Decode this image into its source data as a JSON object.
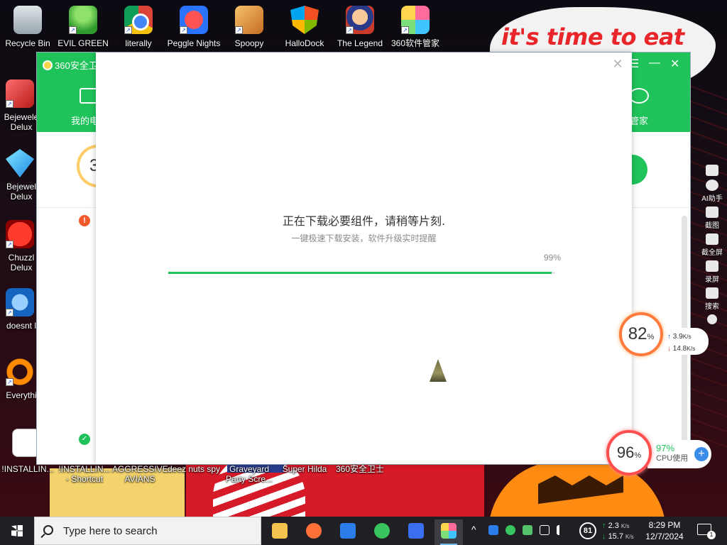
{
  "wallpaper": {
    "bubble_text": "it's time to eat shit"
  },
  "desktop": {
    "top_icons": [
      {
        "label": "Recycle Bin",
        "icon": "recycle-bin-icon"
      },
      {
        "label": "EVIL GREEN",
        "icon": "green-figure-icon"
      },
      {
        "label": "literally",
        "icon": "chrome-icon"
      },
      {
        "label": "Peggle Nights",
        "icon": "peggle-icon"
      },
      {
        "label": "Spoopy",
        "icon": "spoopy-icon"
      },
      {
        "label": "HalloDock",
        "icon": "windows-shield-icon"
      },
      {
        "label": "The Legend",
        "icon": "legend-character-icon"
      },
      {
        "label": "360软件管家",
        "icon": "360-software-icon"
      }
    ],
    "left_icons": [
      {
        "label": "Bejewele Delux",
        "icon": "bejeweled-icon"
      },
      {
        "label": "Bejewel Delux",
        "icon": "bejeweled-diamond-icon"
      },
      {
        "label": "Chuzzl Delux",
        "icon": "chuzzle-icon"
      },
      {
        "label": "doesnt l",
        "icon": "blue-bird-icon"
      },
      {
        "label": "Everythi",
        "icon": "everything-search-icon"
      }
    ],
    "bottom_labels": [
      {
        "label": "!INSTALLIN..."
      },
      {
        "label": "!INSTALLIN... - Shortcut"
      },
      {
        "label": "AGGRESSIVE AVIANS"
      },
      {
        "label": "deez nuts spy"
      },
      {
        "label": "Graveyard Party Scre..."
      },
      {
        "label": "Super Hilda"
      },
      {
        "label": "360安全卫士"
      }
    ]
  },
  "app_window": {
    "title": "360安全卫",
    "nav_left_label": "我的电",
    "nav_right_label": "件管家",
    "menu_glyph": "☰",
    "minimize_glyph": "—",
    "close_glyph": "✕",
    "partial_digit": "3"
  },
  "dialog": {
    "close_glyph": "✕",
    "title": "正在下载必要组件，请稍等片刻.",
    "subtitle": "一键极速下载安装，软件升级实时提醒",
    "progress": {
      "value": 99,
      "label": "99%"
    },
    "accent": "#1fc35a"
  },
  "side_toolbar": {
    "items": [
      {
        "label": "",
        "icon": "shield-check-icon"
      },
      {
        "label": "AI助手",
        "icon": "ai-assistant-icon"
      },
      {
        "label": "截图",
        "icon": "camera-icon"
      },
      {
        "label": "截全屏",
        "icon": "screen-capture-icon"
      },
      {
        "label": "录屏",
        "icon": "video-record-icon"
      },
      {
        "label": "搜索",
        "icon": "search-icon"
      },
      {
        "label": "",
        "icon": "settings-icon"
      }
    ]
  },
  "net_monitor": {
    "percent": "82",
    "unit": "%",
    "upload": "3.9",
    "upload_unit": "K/s",
    "download": "14.8",
    "download_unit": "K/s"
  },
  "cpu_monitor": {
    "percent": "96",
    "unit": "%",
    "cpu_value": "97%",
    "cpu_label": "CPU使用",
    "plus": "+"
  },
  "taskbar": {
    "search_placeholder": "Type here to search",
    "apps": [
      {
        "name": "file-explorer",
        "icon": "folder-icon",
        "color": "#f3c24f"
      },
      {
        "name": "firefox",
        "icon": "firefox-icon",
        "color": "#ff7139"
      },
      {
        "name": "360-shield",
        "icon": "shield-icon",
        "color": "#2b7de9"
      },
      {
        "name": "360-safe",
        "icon": "360-safe-icon",
        "color": "#38c45f"
      },
      {
        "name": "360-guard",
        "icon": "guard-icon",
        "color": "#3a6ff2"
      },
      {
        "name": "360-software-manager",
        "icon": "360-software-icon",
        "color": "#46c2e8"
      }
    ],
    "tray": {
      "chevron": "^",
      "badge": "81",
      "net_up": "2.3",
      "net_down": "15.7",
      "net_unit": "K/s"
    },
    "time": "8:29 PM",
    "date": "12/7/2024",
    "notification_count": "1"
  }
}
